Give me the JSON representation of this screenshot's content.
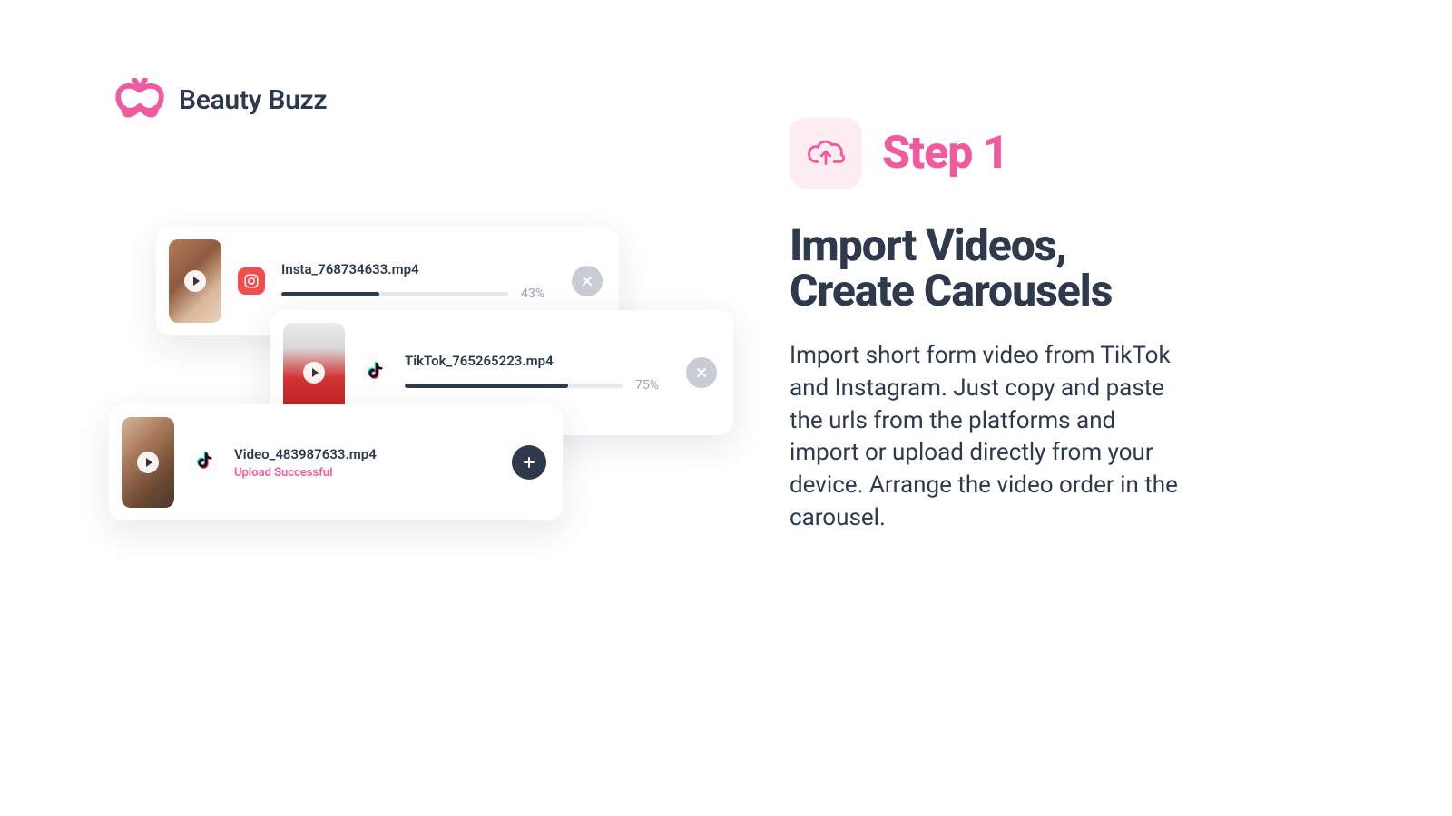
{
  "brand": {
    "name": "Beauty Buzz",
    "accent": "#EF5B9C"
  },
  "step": {
    "label": "Step 1",
    "headline": "Import Videos, Create Carousels",
    "body": "Import short form video from TikTok and Instagram. Just copy and paste the urls from the platforms and import or upload directly from your device. Arrange the video order in the carousel."
  },
  "uploads": [
    {
      "source": "instagram",
      "filename": "Insta_768734633.mp4",
      "progress": 43,
      "progress_label": "43%",
      "state": "uploading"
    },
    {
      "source": "tiktok",
      "filename": "TikTok_765265223.mp4",
      "progress": 75,
      "progress_label": "75%",
      "state": "uploading"
    },
    {
      "source": "tiktok",
      "filename": "Video_483987633.mp4",
      "progress": 100,
      "state": "done",
      "status_text": "Upload Successful"
    }
  ]
}
